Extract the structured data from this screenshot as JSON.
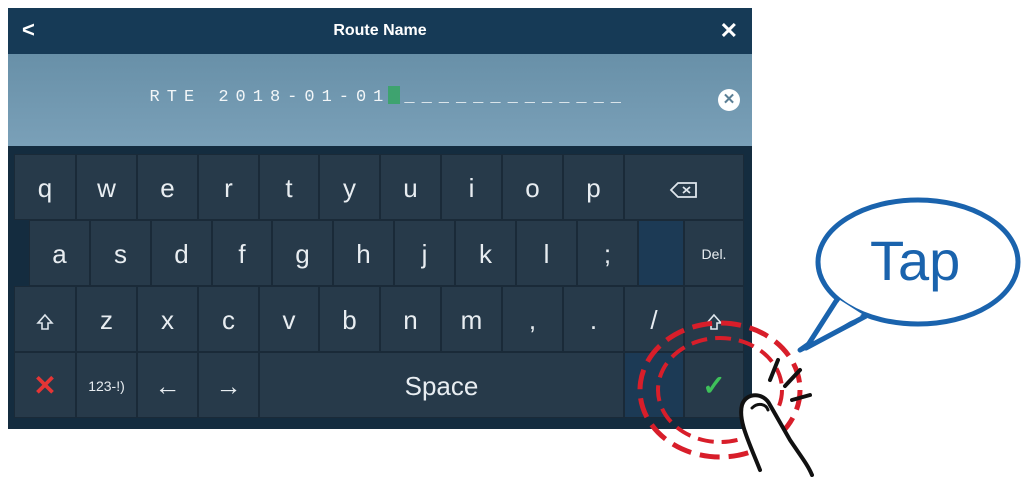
{
  "titlebar": {
    "title": "Route Name",
    "back_label": "<",
    "close_label": "✕"
  },
  "input": {
    "value": "RTE 2018-01-01",
    "placeholder_tail": "_____________",
    "clear_label": "✕"
  },
  "keyboard": {
    "row1": [
      "q",
      "w",
      "e",
      "r",
      "t",
      "y",
      "u",
      "i",
      "o",
      "p"
    ],
    "row2": [
      "a",
      "s",
      "d",
      "f",
      "g",
      "h",
      "j",
      "k",
      "l",
      ";"
    ],
    "row3": [
      "z",
      "x",
      "c",
      "v",
      "b",
      "n",
      "m",
      ",",
      ".",
      "/"
    ],
    "backspace_icon": "backspace-icon",
    "del_label": "Del.",
    "shift_icon": "shift-icon",
    "cancel_label": "✕",
    "numsym_label": "123-!)",
    "left_label": "←",
    "right_label": "→",
    "space_label": "Space",
    "enter_label": "✓",
    "colors": {
      "cancel": "#e53535",
      "enter": "#3ec15a"
    }
  },
  "callout": {
    "text": "Tap",
    "color": "#1a63ad",
    "ring_color": "#d81e2a"
  }
}
